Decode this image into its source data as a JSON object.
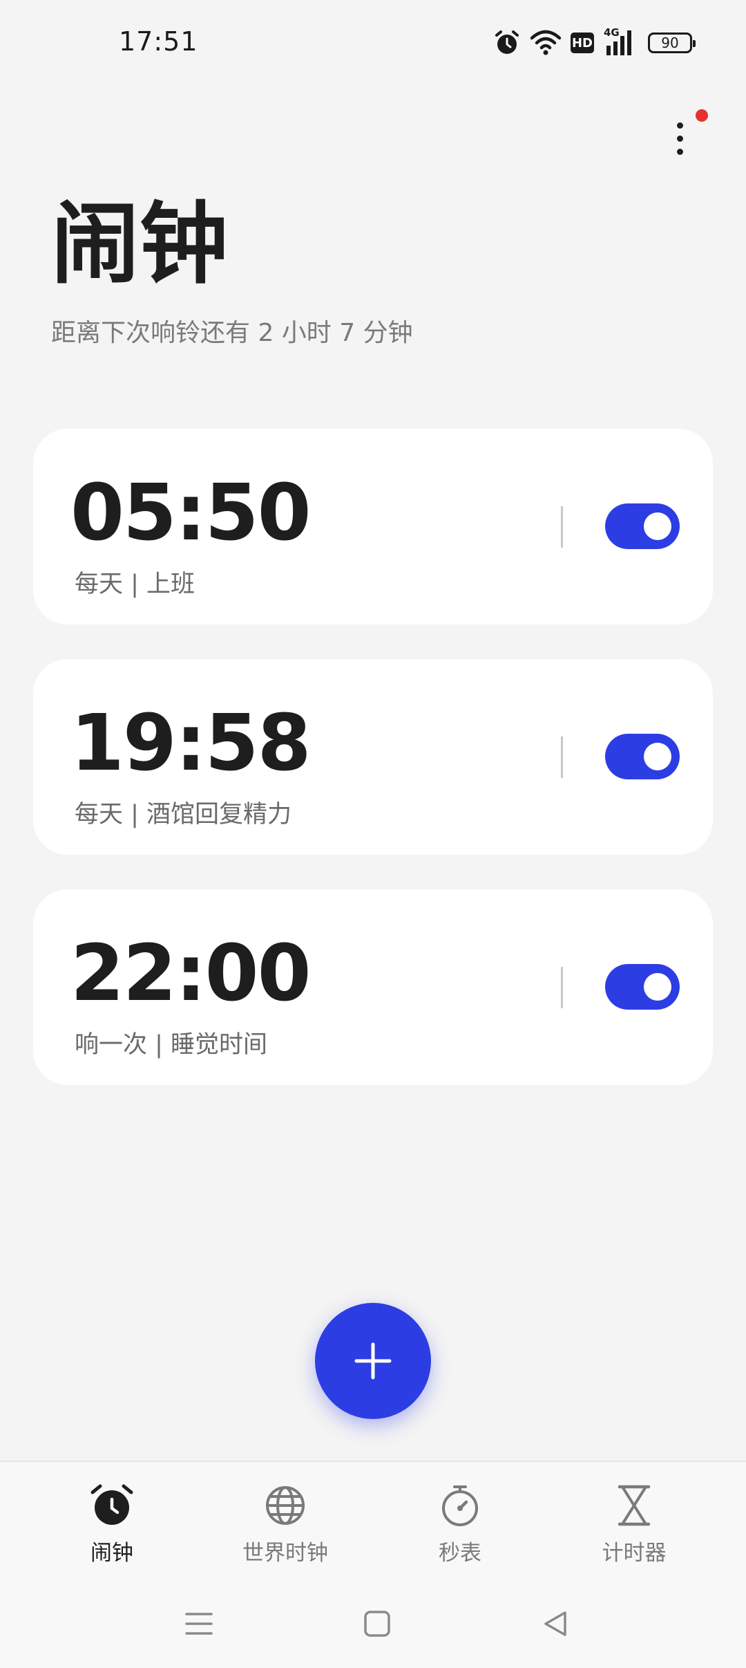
{
  "status_bar": {
    "time": "17:51",
    "network": "4G",
    "hd": "HD",
    "battery": "90",
    "icons": [
      "alarm-icon",
      "wifi-icon",
      "hd-icon",
      "signal-icon",
      "battery-icon"
    ]
  },
  "header": {
    "title": "闹钟",
    "subtitle": "距离下次响铃还有 2 小时 7 分钟",
    "menu_icon": "more-vertical-icon",
    "badge_color": "#e5322d"
  },
  "alarms": [
    {
      "time": "05:50",
      "label": "每天 | 上班",
      "enabled": true
    },
    {
      "time": "19:58",
      "label": "每天 | 酒馆回复精力",
      "enabled": true
    },
    {
      "time": "22:00",
      "label": "响一次 | 睡觉时间",
      "enabled": true
    }
  ],
  "colors": {
    "accent": "#2d3de4",
    "background": "#f4f4f4",
    "card": "#ffffff",
    "text": "#1e1e1e",
    "muted": "#7a7a7a"
  },
  "fab": {
    "icon": "plus-icon"
  },
  "bottom_nav": [
    {
      "label": "闹钟",
      "icon": "alarm-clock-icon",
      "active": true
    },
    {
      "label": "世界时钟",
      "icon": "globe-icon",
      "active": false
    },
    {
      "label": "秒表",
      "icon": "stopwatch-icon",
      "active": false
    },
    {
      "label": "计时器",
      "icon": "hourglass-icon",
      "active": false
    }
  ],
  "system_nav": [
    {
      "icon": "menu-icon"
    },
    {
      "icon": "home-icon"
    },
    {
      "icon": "back-icon"
    }
  ]
}
